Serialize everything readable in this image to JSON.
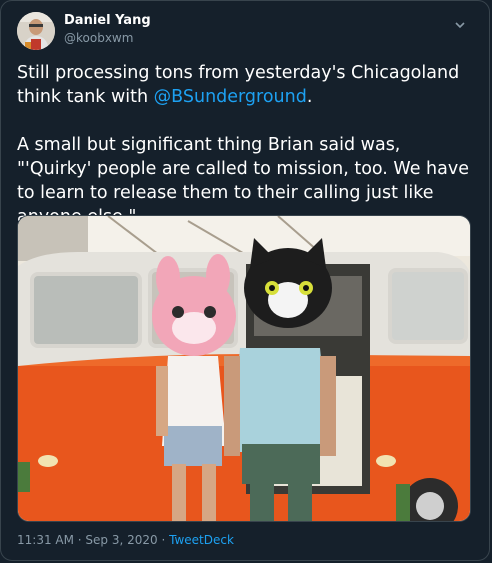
{
  "author": {
    "name": "Daniel Yang",
    "handle": "@koobxwm"
  },
  "tweet": {
    "text_before_mention": "Still processing tons from yesterday's Chicagoland think tank with ",
    "mention": "@BSunderground",
    "text_after_mention": ".\n\nA small but significant thing Brian said was, \"'Quirky' people are called to mission, too. We have to learn to release them to their calling just like anyone else.\""
  },
  "meta": {
    "timestamp": "11:31 AM · Sep 3, 2020",
    "separator": " · ",
    "source": "TweetDeck"
  },
  "icons": {
    "menu": "chevron-down-icon"
  },
  "colors": {
    "background": "#15202b",
    "text": "#ffffff",
    "secondary": "#8899a6",
    "link": "#1da1f2",
    "border": "#38444d"
  }
}
